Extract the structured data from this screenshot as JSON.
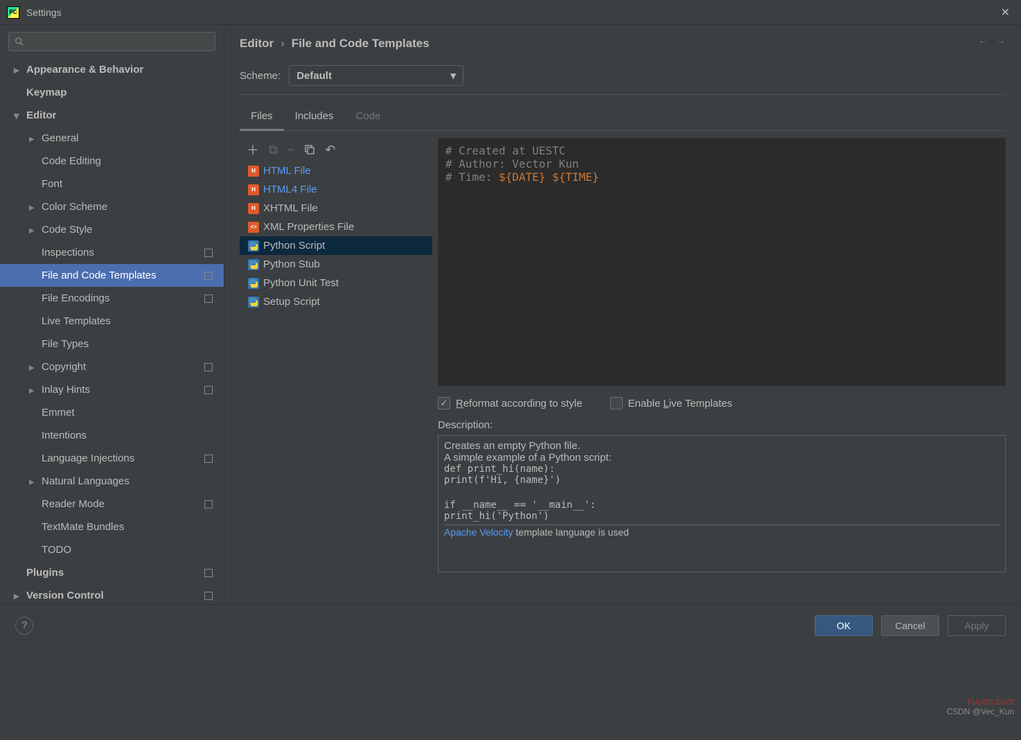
{
  "window": {
    "title": "Settings"
  },
  "search": {
    "placeholder": ""
  },
  "sidebar": {
    "items": [
      {
        "label": "Appearance & Behavior",
        "level": 1,
        "chev": "right"
      },
      {
        "label": "Keymap",
        "level": 1
      },
      {
        "label": "Editor",
        "level": 1,
        "chev": "down"
      },
      {
        "label": "General",
        "level": 2,
        "chev": "right"
      },
      {
        "label": "Code Editing",
        "level": 2
      },
      {
        "label": "Font",
        "level": 2
      },
      {
        "label": "Color Scheme",
        "level": 2,
        "chev": "right"
      },
      {
        "label": "Code Style",
        "level": 2,
        "chev": "right"
      },
      {
        "label": "Inspections",
        "level": 2,
        "badge": true
      },
      {
        "label": "File and Code Templates",
        "level": 2,
        "sel": true,
        "badge": true
      },
      {
        "label": "File Encodings",
        "level": 2,
        "badge": true
      },
      {
        "label": "Live Templates",
        "level": 2
      },
      {
        "label": "File Types",
        "level": 2
      },
      {
        "label": "Copyright",
        "level": 2,
        "chev": "right",
        "badge": true
      },
      {
        "label": "Inlay Hints",
        "level": 2,
        "chev": "right",
        "badge": true
      },
      {
        "label": "Emmet",
        "level": 2
      },
      {
        "label": "Intentions",
        "level": 2
      },
      {
        "label": "Language Injections",
        "level": 2,
        "badge": true
      },
      {
        "label": "Natural Languages",
        "level": 2,
        "chev": "right"
      },
      {
        "label": "Reader Mode",
        "level": 2,
        "badge": true
      },
      {
        "label": "TextMate Bundles",
        "level": 2
      },
      {
        "label": "TODO",
        "level": 2
      },
      {
        "label": "Plugins",
        "level": 1,
        "badge": true
      },
      {
        "label": "Version Control",
        "level": 1,
        "chev": "right",
        "badge": true
      }
    ]
  },
  "breadcrumb": {
    "root": "Editor",
    "leaf": "File and Code Templates"
  },
  "scheme": {
    "label": "Scheme:",
    "value": "Default"
  },
  "tabs": [
    {
      "label": "Files",
      "active": true
    },
    {
      "label": "Includes"
    },
    {
      "label": "Code",
      "dim": true
    }
  ],
  "templates": [
    {
      "label": "HTML File",
      "icon": "html",
      "link": true
    },
    {
      "label": "HTML4 File",
      "icon": "html",
      "link": true
    },
    {
      "label": "XHTML File",
      "icon": "html"
    },
    {
      "label": "XML Properties File",
      "icon": "xml"
    },
    {
      "label": "Python Script",
      "icon": "py",
      "sel": true
    },
    {
      "label": "Python Stub",
      "icon": "py"
    },
    {
      "label": "Python Unit Test",
      "icon": "py"
    },
    {
      "label": "Setup Script",
      "icon": "py"
    }
  ],
  "template_content": {
    "line1": "# Created at UESTC",
    "line2": "# Author: Vector Kun",
    "line3_prefix": "# Time: ",
    "line3_var1": "${DATE}",
    "line3_var2": "${TIME}"
  },
  "checks": {
    "reformat": {
      "label_pre": "R",
      "label_post": "eformat according to style",
      "checked": true
    },
    "live": {
      "label_pre": "Enable ",
      "label_u": "L",
      "label_post": "ive Templates",
      "checked": false
    }
  },
  "description": {
    "label": "Description:",
    "l1": "Creates an empty Python file.",
    "l2": "A simple example of a Python script:",
    "c1": "def print_hi(name):",
    "c2": "        print(f'Hi, {name}')",
    "c3": "if __name__ == '__main__':",
    "c4": "        print_hi('Python')",
    "link": "Apache Velocity",
    "footer_rest": " template language is used"
  },
  "buttons": {
    "ok": "OK",
    "cancel": "Cancel",
    "apply": "Apply"
  },
  "watermark1": "Yuucn.com",
  "watermark2": "CSDN @Vec_Kun"
}
